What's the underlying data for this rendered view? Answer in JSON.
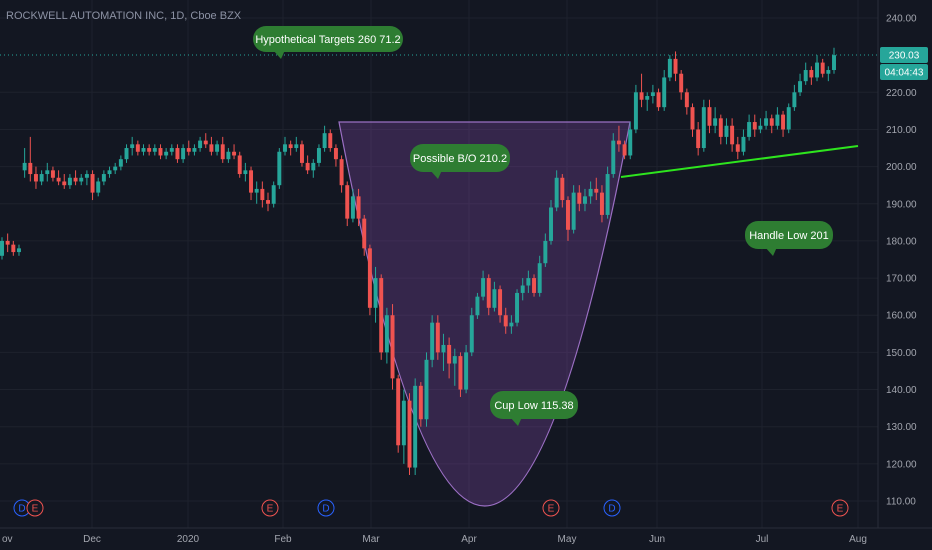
{
  "chart_data": {
    "type": "candlestick",
    "title": "ROCKWELL AUTOMATION INC, 1D, Cboe BZX",
    "y_ticks": [
      110,
      120,
      130,
      140,
      150,
      160,
      170,
      180,
      190,
      200,
      210,
      220,
      240
    ],
    "ylim": [
      106,
      242
    ],
    "x_ticks": [
      "Dec",
      "2020",
      "Feb",
      "Mar",
      "Apr",
      "May",
      "Jun",
      "Jul",
      "Aug"
    ],
    "last_price": "230.03",
    "countdown": "04:04:43",
    "annotations": [
      {
        "text": "Hypothetical Targets  260  71.2"
      },
      {
        "text": "Possible B/O  210.2"
      },
      {
        "text": "Handle Low 201"
      },
      {
        "text": "Cup Low 115.38"
      }
    ],
    "events": [
      "E",
      "E",
      "D",
      "E",
      "D",
      "E"
    ],
    "candles": [
      [
        176,
        181,
        175,
        180
      ],
      [
        180,
        182,
        177,
        179
      ],
      [
        179,
        180,
        176,
        177
      ],
      [
        177,
        179,
        176,
        178
      ],
      [
        199,
        205,
        197,
        201
      ],
      [
        201,
        208,
        196,
        198
      ],
      [
        198,
        200,
        194,
        196
      ],
      [
        196,
        199,
        195,
        198
      ],
      [
        198,
        201,
        196,
        199
      ],
      [
        199,
        200,
        196,
        197
      ],
      [
        197,
        199,
        195,
        196
      ],
      [
        196,
        198,
        194,
        195
      ],
      [
        195,
        198,
        194,
        197
      ],
      [
        197,
        199,
        195,
        196
      ],
      [
        196,
        198,
        195,
        197
      ],
      [
        197,
        199,
        195,
        198
      ],
      [
        198,
        199,
        191,
        193
      ],
      [
        193,
        197,
        192,
        196
      ],
      [
        196,
        199,
        195,
        198
      ],
      [
        198,
        200,
        197,
        199
      ],
      [
        199,
        201,
        198,
        200
      ],
      [
        200,
        203,
        199,
        202
      ],
      [
        202,
        206,
        201,
        205
      ],
      [
        205,
        208,
        203,
        206
      ],
      [
        206,
        207,
        203,
        204
      ],
      [
        204,
        206,
        203,
        205
      ],
      [
        205,
        206,
        203,
        204
      ],
      [
        204,
        206,
        203,
        205
      ],
      [
        205,
        206,
        202,
        203
      ],
      [
        203,
        205,
        202,
        204
      ],
      [
        204,
        206,
        203,
        205
      ],
      [
        205,
        206,
        201,
        202
      ],
      [
        202,
        206,
        201,
        205
      ],
      [
        205,
        207,
        203,
        204
      ],
      [
        204,
        206,
        203,
        205
      ],
      [
        205,
        208,
        204,
        207
      ],
      [
        207,
        209,
        205,
        206
      ],
      [
        206,
        208,
        203,
        204
      ],
      [
        204,
        207,
        203,
        206
      ],
      [
        206,
        208,
        201,
        202
      ],
      [
        202,
        205,
        201,
        204
      ],
      [
        204,
        206,
        202,
        203
      ],
      [
        203,
        204,
        197,
        198
      ],
      [
        198,
        201,
        196,
        199
      ],
      [
        199,
        200,
        191,
        193
      ],
      [
        193,
        196,
        190,
        194
      ],
      [
        194,
        196,
        189,
        191
      ],
      [
        191,
        193,
        188,
        190
      ],
      [
        190,
        196,
        189,
        195
      ],
      [
        195,
        205,
        194,
        204
      ],
      [
        204,
        208,
        203,
        206
      ],
      [
        206,
        207,
        203,
        205
      ],
      [
        205,
        208,
        204,
        206
      ],
      [
        206,
        207,
        200,
        201
      ],
      [
        201,
        203,
        198,
        199
      ],
      [
        199,
        202,
        197,
        201
      ],
      [
        201,
        206,
        200,
        205
      ],
      [
        205,
        211,
        204,
        209
      ],
      [
        209,
        210,
        204,
        205
      ],
      [
        205,
        206,
        200,
        202
      ],
      [
        202,
        203,
        193,
        195
      ],
      [
        195,
        196,
        184,
        186
      ],
      [
        186,
        194,
        185,
        192
      ],
      [
        192,
        194,
        184,
        186
      ],
      [
        186,
        187,
        176,
        178
      ],
      [
        178,
        179,
        160,
        162
      ],
      [
        162,
        173,
        158,
        170
      ],
      [
        170,
        171,
        148,
        150
      ],
      [
        150,
        162,
        147,
        160
      ],
      [
        160,
        163,
        140,
        143
      ],
      [
        143,
        144,
        123,
        125
      ],
      [
        125,
        140,
        120,
        137
      ],
      [
        137,
        139,
        117,
        119
      ],
      [
        119,
        143,
        117,
        141
      ],
      [
        141,
        142,
        130,
        132
      ],
      [
        132,
        150,
        130,
        148
      ],
      [
        148,
        160,
        146,
        158
      ],
      [
        158,
        160,
        148,
        150
      ],
      [
        150,
        155,
        145,
        152
      ],
      [
        152,
        154,
        143,
        147
      ],
      [
        147,
        151,
        141,
        149
      ],
      [
        149,
        150,
        138,
        140
      ],
      [
        140,
        152,
        139,
        150
      ],
      [
        150,
        162,
        149,
        160
      ],
      [
        160,
        166,
        159,
        165
      ],
      [
        165,
        172,
        164,
        170
      ],
      [
        170,
        171,
        160,
        162
      ],
      [
        162,
        169,
        161,
        167
      ],
      [
        167,
        168,
        158,
        160
      ],
      [
        160,
        162,
        155,
        157
      ],
      [
        157,
        160,
        155,
        158
      ],
      [
        158,
        167,
        157,
        166
      ],
      [
        166,
        170,
        164,
        168
      ],
      [
        168,
        172,
        166,
        170
      ],
      [
        170,
        171,
        165,
        166
      ],
      [
        166,
        176,
        165,
        174
      ],
      [
        174,
        182,
        173,
        180
      ],
      [
        180,
        191,
        179,
        189
      ],
      [
        189,
        199,
        188,
        197
      ],
      [
        197,
        198,
        189,
        191
      ],
      [
        191,
        192,
        180,
        183
      ],
      [
        183,
        195,
        182,
        193
      ],
      [
        193,
        195,
        188,
        190
      ],
      [
        190,
        194,
        188,
        192
      ],
      [
        192,
        196,
        190,
        194
      ],
      [
        194,
        197,
        191,
        193
      ],
      [
        193,
        195,
        185,
        187
      ],
      [
        187,
        200,
        186,
        198
      ],
      [
        198,
        209,
        197,
        207
      ],
      [
        207,
        211,
        204,
        206
      ],
      [
        206,
        207,
        202,
        203
      ],
      [
        203,
        212,
        202,
        210
      ],
      [
        210,
        222,
        209,
        220
      ],
      [
        220,
        225,
        216,
        218
      ],
      [
        218,
        220,
        215,
        219
      ],
      [
        219,
        222,
        217,
        220
      ],
      [
        220,
        221,
        215,
        216
      ],
      [
        216,
        226,
        215,
        224
      ],
      [
        224,
        230,
        223,
        229
      ],
      [
        229,
        231,
        223,
        225
      ],
      [
        225,
        226,
        218,
        220
      ],
      [
        220,
        221,
        214,
        216
      ],
      [
        216,
        217,
        208,
        210
      ],
      [
        210,
        212,
        203,
        205
      ],
      [
        205,
        218,
        204,
        216
      ],
      [
        216,
        218,
        209,
        211
      ],
      [
        211,
        216,
        209,
        213
      ],
      [
        213,
        214,
        206,
        208
      ],
      [
        208,
        213,
        206,
        211
      ],
      [
        211,
        213,
        204,
        206
      ],
      [
        206,
        208,
        202,
        204
      ],
      [
        204,
        210,
        203,
        208
      ],
      [
        208,
        214,
        207,
        212
      ],
      [
        212,
        214,
        208,
        210
      ],
      [
        210,
        213,
        209,
        211
      ],
      [
        211,
        215,
        210,
        213
      ],
      [
        213,
        214,
        209,
        211
      ],
      [
        211,
        216,
        210,
        214
      ],
      [
        214,
        215,
        208,
        210
      ],
      [
        210,
        217,
        209,
        216
      ],
      [
        216,
        222,
        215,
        220
      ],
      [
        220,
        225,
        219,
        223
      ],
      [
        223,
        228,
        222,
        226
      ],
      [
        226,
        227,
        222,
        224
      ],
      [
        224,
        230,
        223,
        228
      ],
      [
        228,
        229,
        224,
        225
      ],
      [
        225,
        227,
        223,
        226
      ],
      [
        226,
        232,
        225,
        230
      ]
    ]
  }
}
